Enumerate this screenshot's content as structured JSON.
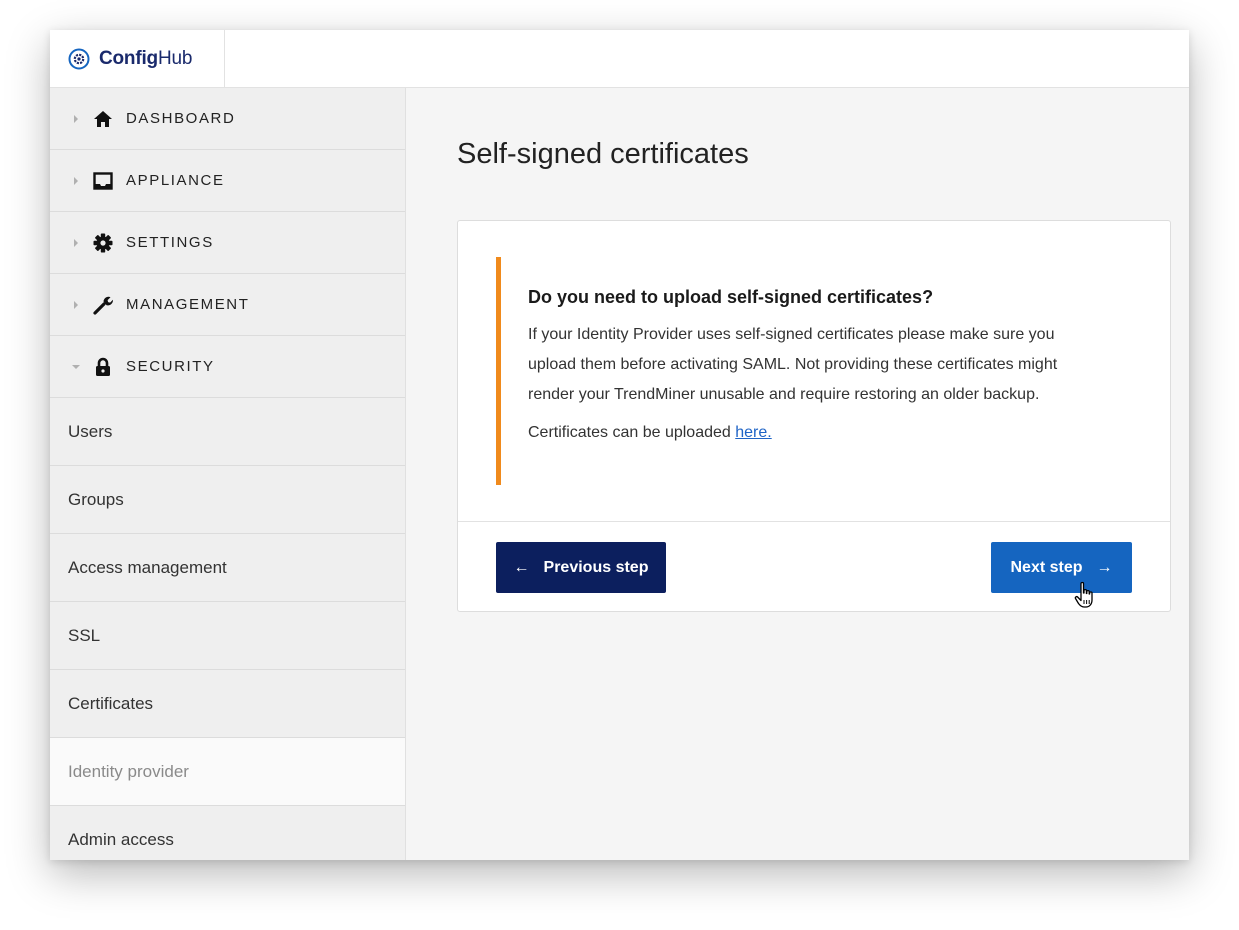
{
  "app": {
    "logo_bold": "Config",
    "logo_regular": "Hub",
    "logo_icon": "gear-circle-icon"
  },
  "sidebar": {
    "groups": [
      {
        "label": "DASHBOARD",
        "icon": "home-icon",
        "expanded": false
      },
      {
        "label": "APPLIANCE",
        "icon": "inbox-icon",
        "expanded": false
      },
      {
        "label": "SETTINGS",
        "icon": "gear-icon",
        "expanded": false
      },
      {
        "label": "MANAGEMENT",
        "icon": "wrench-icon",
        "expanded": false
      },
      {
        "label": "SECURITY",
        "icon": "lock-icon",
        "expanded": true
      }
    ],
    "security_items": [
      {
        "label": "Users"
      },
      {
        "label": "Groups"
      },
      {
        "label": "Access management"
      },
      {
        "label": "SSL"
      },
      {
        "label": "Certificates"
      },
      {
        "label": "Identity provider",
        "active": true
      },
      {
        "label": "Admin access"
      }
    ]
  },
  "main": {
    "title": "Self-signed certificates",
    "callout": {
      "accent_color": "#f08a1c",
      "heading": "Do you need to upload self-signed certificates?",
      "line1": "If your Identity Provider uses self-signed certificates please make sure you",
      "line2": "upload them before activating SAML. Not providing these certificates might",
      "line3": "render your TrendMiner unusable and require restoring an older backup.",
      "link_prefix": "Certificates can be uploaded ",
      "link_text": "here."
    },
    "buttons": {
      "previous_label": "Previous step",
      "previous_arrow": "←",
      "next_label": "Next step",
      "next_arrow": "→",
      "previous_color": "#0c1f5e",
      "next_color": "#1565c0"
    }
  }
}
